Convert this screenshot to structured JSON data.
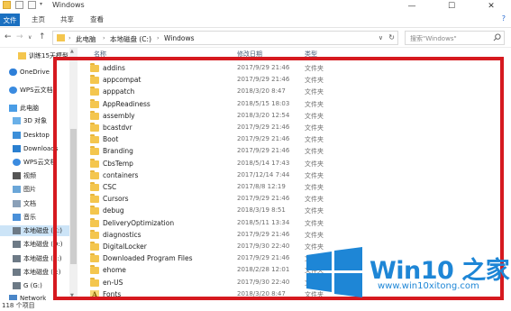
{
  "window": {
    "title": "Windows",
    "minimize": "—",
    "maximize": "☐",
    "close": "✕"
  },
  "ribbon": {
    "file": "文件",
    "home": "主页",
    "share": "共享",
    "view": "查看",
    "help": "?"
  },
  "address": {
    "crumbs": [
      "此电脑",
      "本地磁盘 (C:)",
      "Windows"
    ],
    "search_placeholder": "搜索\"Windows\""
  },
  "sidebar": {
    "items": [
      {
        "label": "训练15天模型",
        "icon": "folder-icon"
      },
      {
        "label": "OneDrive",
        "icon": "onedrive-icon"
      },
      {
        "label": "WPS云文档",
        "icon": "cloud-icon"
      },
      {
        "label": "此电脑",
        "icon": "computer-icon"
      },
      {
        "label": "3D 对象",
        "icon": "3d-objects-icon"
      },
      {
        "label": "Desktop",
        "icon": "desktop-icon"
      },
      {
        "label": "Downloads",
        "icon": "downloads-icon"
      },
      {
        "label": "WPS云文档",
        "icon": "cloud-icon"
      },
      {
        "label": "视频",
        "icon": "videos-icon"
      },
      {
        "label": "图片",
        "icon": "pictures-icon"
      },
      {
        "label": "文档",
        "icon": "documents-icon"
      },
      {
        "label": "音乐",
        "icon": "music-icon"
      },
      {
        "label": "本地磁盘 (C:)",
        "icon": "drive-icon"
      },
      {
        "label": "本地磁盘 (D:)",
        "icon": "drive-icon"
      },
      {
        "label": "本地磁盘 (E:)",
        "icon": "drive-icon"
      },
      {
        "label": "本地磁盘 (F:)",
        "icon": "drive-icon"
      },
      {
        "label": "G (G:)",
        "icon": "drive-icon"
      },
      {
        "label": "Network",
        "icon": "network-icon"
      }
    ]
  },
  "columns": {
    "name": "名称",
    "date": "修改日期",
    "type": "类型"
  },
  "files": [
    {
      "name": "addins",
      "date": "2017/9/29 21:46",
      "type": "文件夹",
      "icon": "folder-icon"
    },
    {
      "name": "appcompat",
      "date": "2017/9/29 21:46",
      "type": "文件夹",
      "icon": "folder-icon"
    },
    {
      "name": "apppatch",
      "date": "2018/3/20 8:47",
      "type": "文件夹",
      "icon": "folder-icon"
    },
    {
      "name": "AppReadiness",
      "date": "2018/5/15 18:03",
      "type": "文件夹",
      "icon": "folder-icon"
    },
    {
      "name": "assembly",
      "date": "2018/3/20 12:54",
      "type": "文件夹",
      "icon": "folder-icon"
    },
    {
      "name": "bcastdvr",
      "date": "2017/9/29 21:46",
      "type": "文件夹",
      "icon": "folder-icon"
    },
    {
      "name": "Boot",
      "date": "2017/9/29 21:46",
      "type": "文件夹",
      "icon": "folder-icon"
    },
    {
      "name": "Branding",
      "date": "2017/9/29 21:46",
      "type": "文件夹",
      "icon": "folder-icon"
    },
    {
      "name": "CbsTemp",
      "date": "2018/5/14 17:43",
      "type": "文件夹",
      "icon": "folder-icon"
    },
    {
      "name": "containers",
      "date": "2017/12/14 7:44",
      "type": "文件夹",
      "icon": "folder-icon"
    },
    {
      "name": "CSC",
      "date": "2017/8/8 12:19",
      "type": "文件夹",
      "icon": "folder-icon"
    },
    {
      "name": "Cursors",
      "date": "2017/9/29 21:46",
      "type": "文件夹",
      "icon": "folder-icon"
    },
    {
      "name": "debug",
      "date": "2018/3/19 8:51",
      "type": "文件夹",
      "icon": "folder-icon"
    },
    {
      "name": "DeliveryOptimization",
      "date": "2018/5/11 13:34",
      "type": "文件夹",
      "icon": "folder-icon"
    },
    {
      "name": "diagnostics",
      "date": "2017/9/29 21:46",
      "type": "文件夹",
      "icon": "folder-icon"
    },
    {
      "name": "DigitalLocker",
      "date": "2017/9/30 22:40",
      "type": "文件夹",
      "icon": "folder-icon"
    },
    {
      "name": "Downloaded Program Files",
      "date": "2017/9/29 21:46",
      "type": "文件夹",
      "icon": "folder-icon"
    },
    {
      "name": "ehome",
      "date": "2018/2/28 12:01",
      "type": "文件夹",
      "icon": "folder-icon"
    },
    {
      "name": "en-US",
      "date": "2017/9/30 22:40",
      "type": "文件夹",
      "icon": "folder-icon"
    },
    {
      "name": "Fonts",
      "date": "2018/3/20 8:47",
      "type": "文件夹",
      "icon": "fonts-folder-icon"
    }
  ],
  "status": {
    "item_count": "118 个项目"
  },
  "watermark": {
    "brand": "Win10 之家",
    "url": "www.win10xitong.com",
    "color": "#1e86d6"
  },
  "colors": {
    "annotation_red": "#d6191f",
    "selected_blue": "#cce4f7",
    "folder_yellow": "#f4c64e"
  }
}
